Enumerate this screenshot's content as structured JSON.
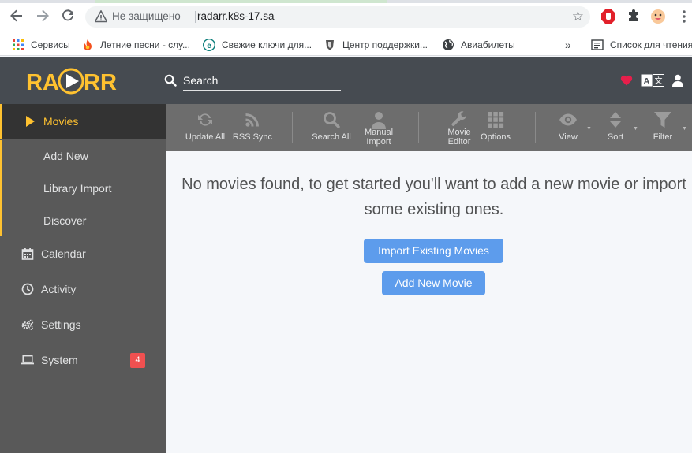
{
  "browser": {
    "insecure_label": "Не защищено",
    "url": "radarr.k8s-17.sa",
    "bookmarks": [
      {
        "label": "Сервисы",
        "icon": "apps-grid-icon"
      },
      {
        "label": "Летние песни - слу...",
        "icon": "fire-icon"
      },
      {
        "label": "Свежие ключи для...",
        "icon": "eset-icon"
      },
      {
        "label": "Центр поддержки...",
        "icon": "tank-icon"
      },
      {
        "label": "Авиабилеты",
        "icon": "globe-icon"
      }
    ],
    "more_bookmarks": "»",
    "reading_list": "Список для чтения"
  },
  "header": {
    "search_placeholder": "Search"
  },
  "sidebar": {
    "items": [
      {
        "label": "Movies",
        "icon": "play-icon",
        "active": true
      },
      {
        "label": "Calendar",
        "icon": "calendar-icon"
      },
      {
        "label": "Activity",
        "icon": "clock-icon"
      },
      {
        "label": "Settings",
        "icon": "gears-icon"
      },
      {
        "label": "System",
        "icon": "laptop-icon",
        "badge": "4"
      }
    ],
    "movies_sub": [
      {
        "label": "Add New"
      },
      {
        "label": "Library Import"
      },
      {
        "label": "Discover"
      }
    ]
  },
  "toolbar": {
    "update_all": "Update All",
    "rss_sync": "RSS Sync",
    "search_all": "Search All",
    "manual_import_1": "Manual",
    "manual_import_2": "Import",
    "movie_editor_1": "Movie",
    "movie_editor_2": "Editor",
    "options": "Options",
    "view": "View",
    "sort": "Sort",
    "filter": "Filter"
  },
  "main": {
    "empty_line1": "No movies found, to get started you'll want to add a new movie or import",
    "empty_line2": "some existing ones.",
    "import_existing": "Import Existing Movies",
    "add_new": "Add New Movie"
  },
  "colors": {
    "accent": "#ffc230",
    "primary_button": "#5d9cec",
    "badge": "#f05050",
    "header": "#464b51",
    "sidebar": "#595959",
    "toolbar": "#6d6d6d"
  }
}
